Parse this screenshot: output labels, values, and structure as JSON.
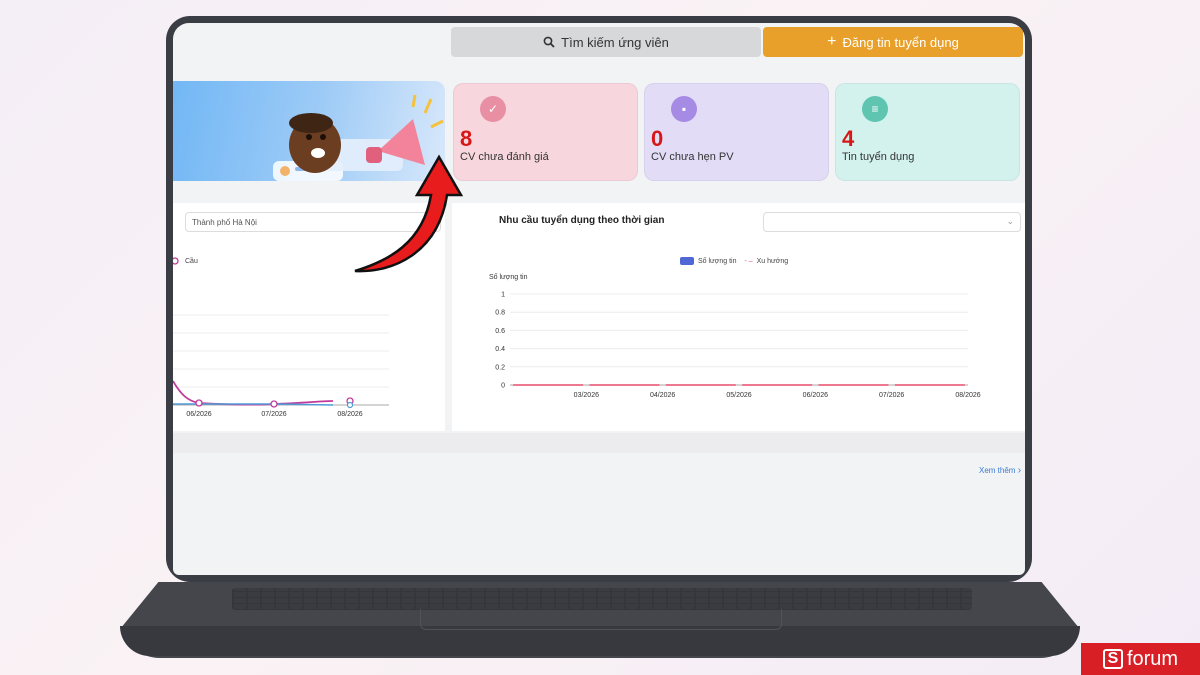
{
  "header": {
    "search_label": "Tìm kiếm ứng viên",
    "post_label": "Đăng tin tuyển dụng"
  },
  "stats": [
    {
      "value": "8",
      "label": "CV chưa đánh giá"
    },
    {
      "value": "0",
      "label": "CV chưa hẹn PV"
    },
    {
      "value": "4",
      "label": "Tin tuyển dụng"
    }
  ],
  "left_panel": {
    "city_select": "Thành phố Hà Nội",
    "legend": "Cầu",
    "x_ticks": [
      "06/2026",
      "07/2026",
      "08/2026"
    ]
  },
  "right_panel": {
    "title": "Nhu cầu tuyển dụng theo thời gian",
    "select_value": "",
    "legend_bar": "Số lượng tin",
    "legend_line": "Xu hướng",
    "y_label": "Số lượng tin",
    "y_ticks": [
      "1",
      "0.8",
      "0.6",
      "0.4",
      "0.2",
      "0"
    ],
    "x_ticks": [
      "03/2026",
      "04/2026",
      "05/2026",
      "06/2026",
      "07/2026",
      "08/2026"
    ]
  },
  "chart_data": {
    "type": "bar",
    "categories": [
      "03/2026",
      "04/2026",
      "05/2026",
      "06/2026",
      "07/2026",
      "08/2026"
    ],
    "series": [
      {
        "name": "Số lượng tin",
        "values": [
          0,
          0,
          0,
          0,
          0,
          0
        ]
      },
      {
        "name": "Xu hướng",
        "values": [
          0,
          0,
          0,
          0,
          0,
          0
        ]
      }
    ],
    "title": "Nhu cầu tuyển dụng theo thời gian",
    "ylabel": "Số lượng tin",
    "ylim": [
      0,
      1
    ],
    "grid": true,
    "legend": "top"
  },
  "footer": {
    "see_more": "Xem thêm"
  },
  "brand": {
    "name": "forum",
    "logo_letter": "S",
    "accent": "#d81f26"
  },
  "colors": {
    "post_button": "#e9a02a",
    "stat_value": "#d71717",
    "bar_series": "#4f68d6",
    "trend_series": "#e84c6a"
  }
}
